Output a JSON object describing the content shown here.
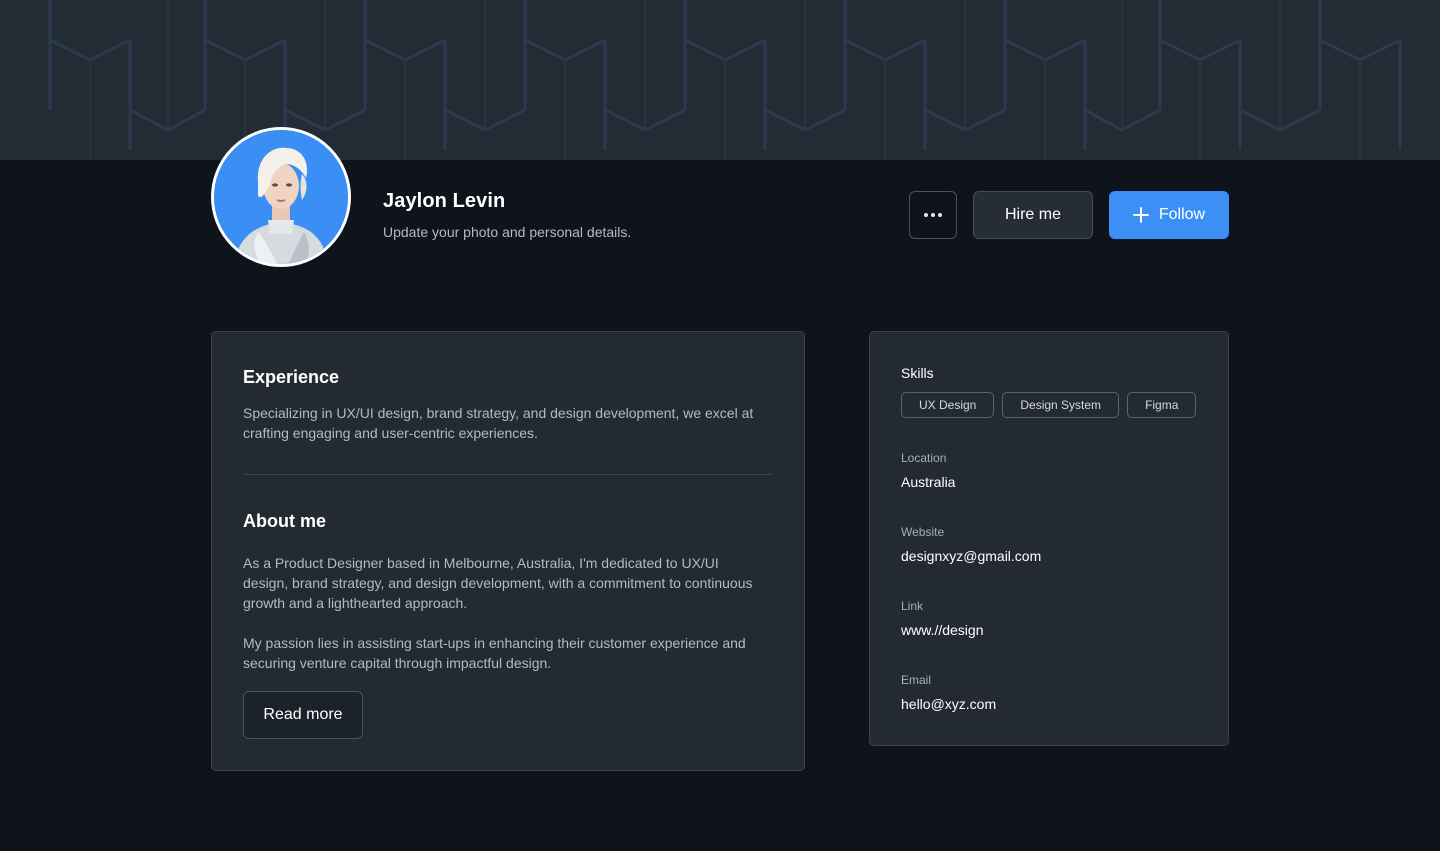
{
  "profile": {
    "name": "Jaylon Levin",
    "subtitle": "Update your photo and personal details."
  },
  "actions": {
    "more_icon": "more-horizontal-icon",
    "hire_label": "Hire me",
    "follow_label": "Follow",
    "follow_icon": "plus-icon"
  },
  "experience": {
    "title": "Experience",
    "text": "Specializing in UX/UI design, brand strategy, and design development, we excel at crafting engaging and user-centric experiences."
  },
  "about": {
    "title": "About me",
    "paragraph1": "As a Product Designer based in Melbourne, Australia, I'm dedicated to UX/UI design, brand strategy, and design development, with a commitment to continuous growth and a lighthearted approach.",
    "paragraph2": "My passion lies in assisting start-ups in enhancing their customer experience and securing venture capital through impactful design.",
    "read_more_label": "Read more"
  },
  "details": {
    "skills_title": "Skills",
    "skills": [
      "UX Design",
      "Design System",
      "Figma"
    ],
    "location_label": "Location",
    "location_value": "Australia",
    "website_label": "Website",
    "website_value": "designxyz@gmail.com",
    "link_label": "Link",
    "link_value": "www.//design",
    "email_label": "Email",
    "email_value": "hello@xyz.com"
  },
  "colors": {
    "page_bg": "#0f141c",
    "card_bg": "#232a32",
    "accent": "#3b8ff5",
    "avatar_bg": "#3a8ef4"
  }
}
